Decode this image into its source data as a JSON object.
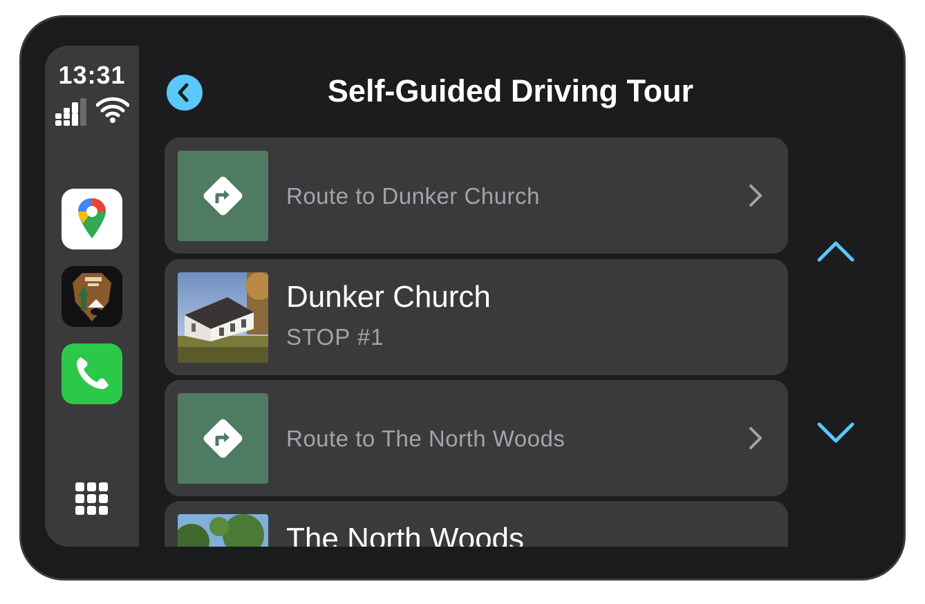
{
  "status": {
    "time": "13:31"
  },
  "dock": {
    "apps": [
      {
        "name": "Google Maps",
        "icon": "google-maps-icon"
      },
      {
        "name": "National Park Service",
        "icon": "nps-arrowhead-icon"
      },
      {
        "name": "Phone",
        "icon": "phone-icon"
      }
    ],
    "launcher_icon": "app-grid-icon"
  },
  "header": {
    "title": "Self-Guided Driving Tour",
    "back_icon": "chevron-left-icon"
  },
  "list": {
    "items": [
      {
        "type": "route",
        "label": "Route to Dunker Church",
        "icon": "turn-right-sign-icon"
      },
      {
        "type": "stop",
        "title": "Dunker Church",
        "subtitle": "STOP #1"
      },
      {
        "type": "route",
        "label": "Route to The North Woods",
        "icon": "turn-right-sign-icon"
      },
      {
        "type": "stop",
        "title": "The North Woods",
        "subtitle": ""
      }
    ]
  },
  "colors": {
    "accent": "#5ac8fa",
    "route_tile": "#4f7b62",
    "row_bg": "#3a3a3c",
    "screen_bg": "#1c1c1e"
  }
}
